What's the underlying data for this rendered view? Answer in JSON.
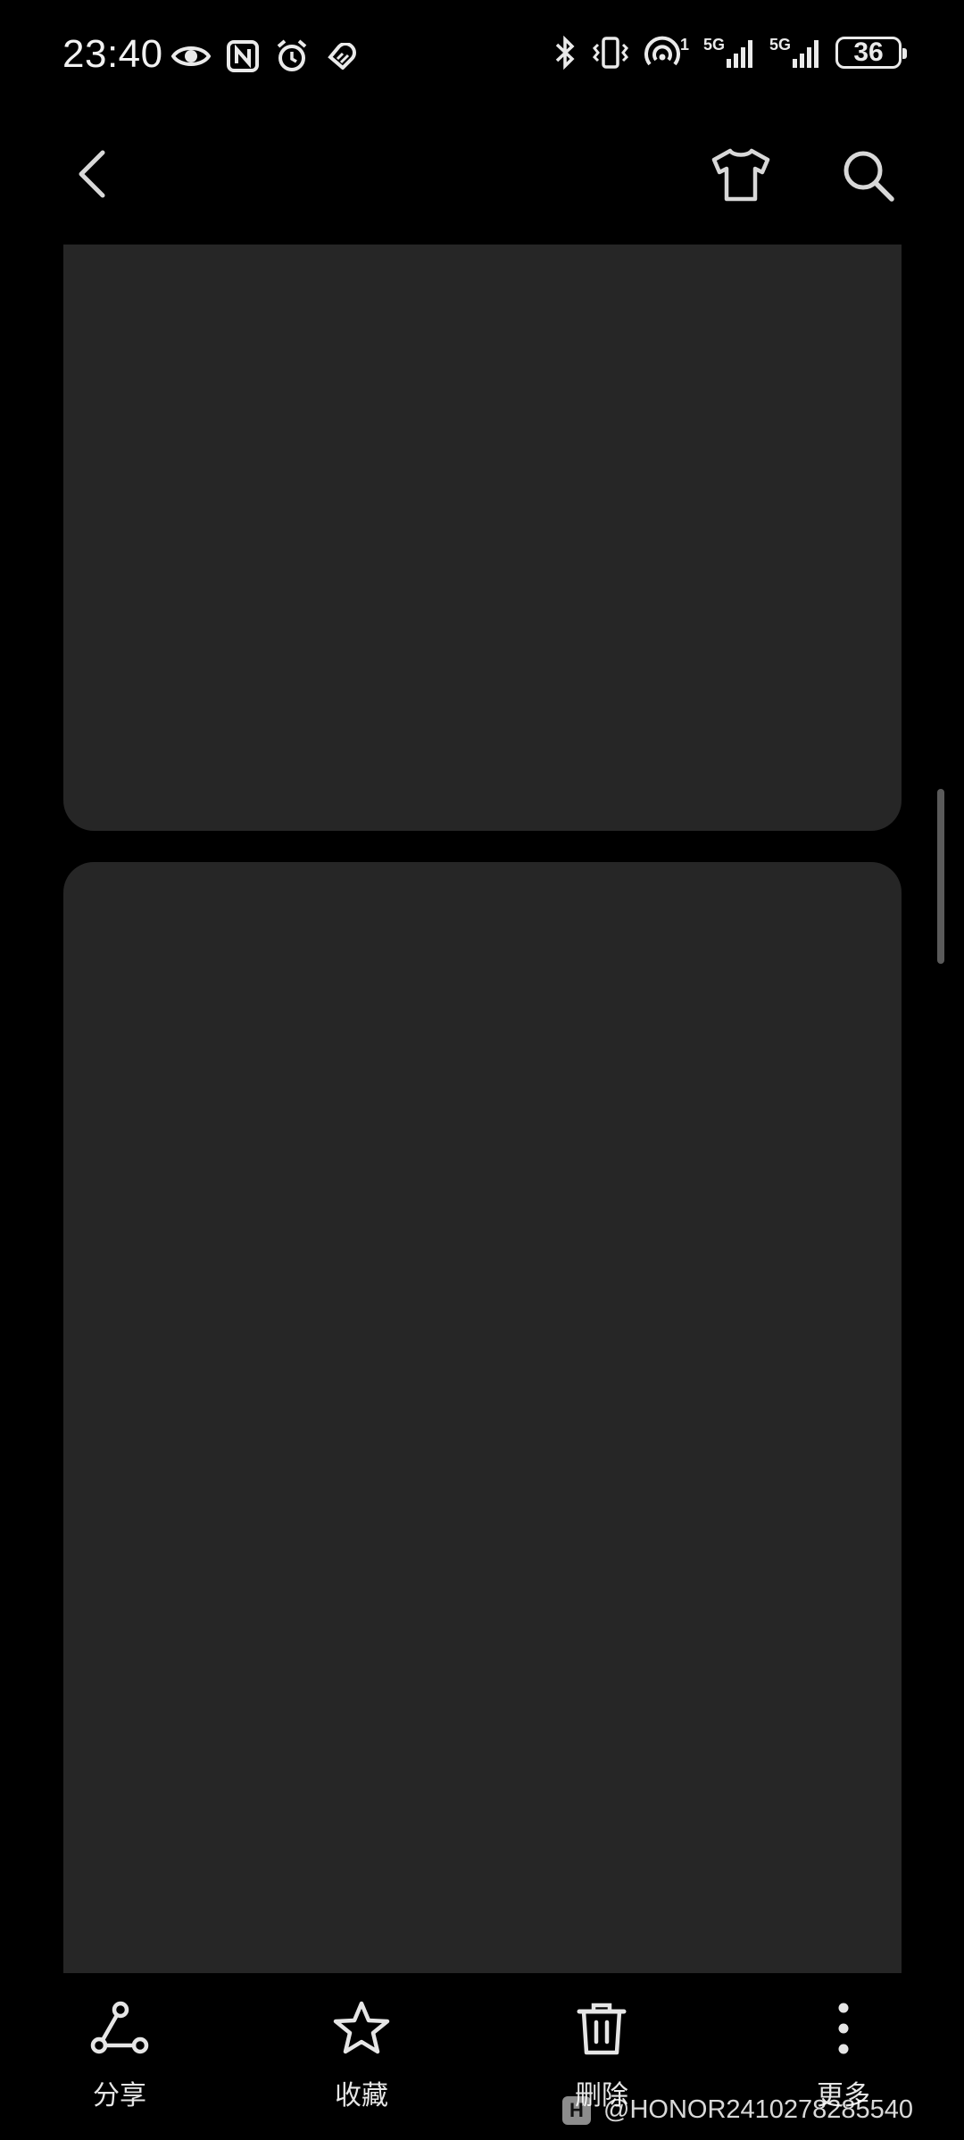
{
  "status_bar": {
    "time": "23:40",
    "left_icons": [
      "eye-icon",
      "nfc-icon",
      "alarm-icon",
      "health-icon"
    ],
    "right_icons": [
      "bluetooth-icon",
      "vibrate-icon",
      "hotspot-icon",
      "signal-5g-1-icon",
      "signal-5g-2-icon"
    ],
    "hotspot_count": "1",
    "network_1": "5G",
    "network_2": "5G",
    "battery": "36"
  },
  "toolbar": {
    "back_icon": "chevron-left-icon",
    "theme_icon": "tshirt-icon",
    "search_icon": "search-icon"
  },
  "actions": {
    "share": {
      "label": "分享",
      "icon": "share-icon"
    },
    "favorite": {
      "label": "收藏",
      "icon": "star-icon"
    },
    "delete": {
      "label": "删除",
      "icon": "trash-icon"
    },
    "more": {
      "label": "更多",
      "icon": "more-vertical-icon"
    }
  },
  "watermark": {
    "logo": "H",
    "text": "@HONOR2410278285540"
  },
  "colors": {
    "background": "#000000",
    "card": "#262626",
    "icon": "#e6e6e6"
  }
}
